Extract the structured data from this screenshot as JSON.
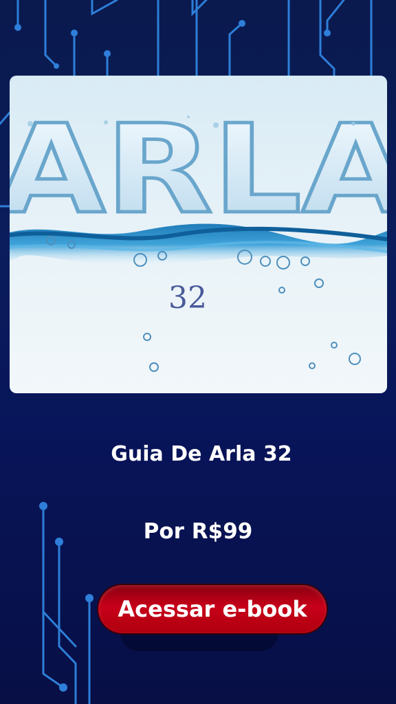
{
  "cover": {
    "word": "ARLA",
    "number": "32"
  },
  "product": {
    "title": "Guia De Arla 32",
    "price": "Por R$99"
  },
  "cta": {
    "label": "Acessar e-book"
  },
  "colors": {
    "background": "#0a1a4e",
    "circuit": "#2e7fd9",
    "cta": "#c70019",
    "text": "#ffffff"
  }
}
